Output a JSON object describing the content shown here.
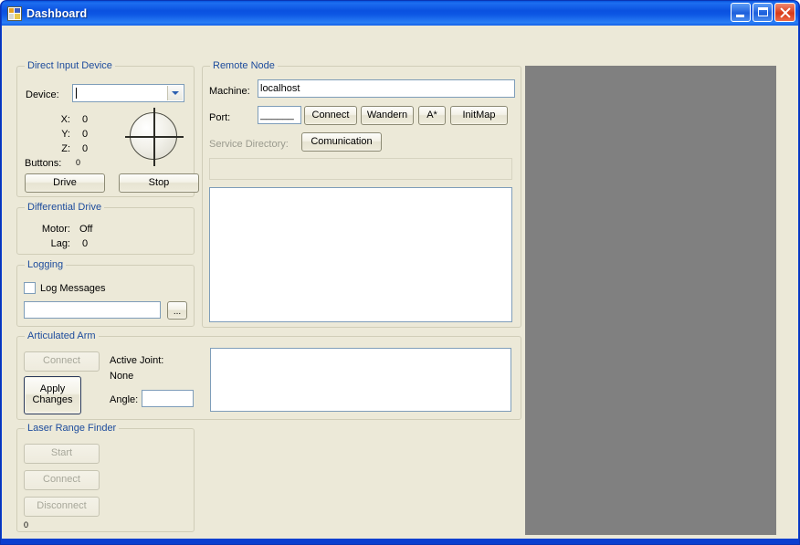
{
  "window": {
    "title": "Dashboard",
    "icon": "app-grid-icon",
    "controls": {
      "minimize": "Minimize",
      "maximize": "Maximize",
      "close": "Close"
    },
    "colors": {
      "titlebar": "#0d57e4",
      "client_background": "#ece9d8",
      "group_legend": "#1c4b9c",
      "render_panel": "#808080"
    }
  },
  "direct_input_device": {
    "legend": "Direct Input Device",
    "device_label": "Device:",
    "device_value": "",
    "device_placeholder": "",
    "axes": [
      {
        "label": "X:",
        "value": "0"
      },
      {
        "label": "Y:",
        "value": "0"
      },
      {
        "label": "Z:",
        "value": "0"
      }
    ],
    "buttons_label": "Buttons:",
    "buttons_value": "0",
    "drive_button": "Drive",
    "stop_button": "Stop",
    "joystick_icon": "joystick-crosshair-icon"
  },
  "differential_drive": {
    "legend": "Differential Drive",
    "motor_label": "Motor:",
    "motor_value": "Off",
    "lag_label": "Lag:",
    "lag_value": "0"
  },
  "logging": {
    "legend": "Logging",
    "log_messages_label": "Log Messages",
    "log_messages_checked": false,
    "path_value": "",
    "path_placeholder": "",
    "browse_button": "..."
  },
  "articulated_arm": {
    "legend": "Articulated Arm",
    "connect_button": "Connect",
    "connect_enabled": false,
    "apply_button_line1": "Apply",
    "apply_button_line2": "Changes",
    "active_joint_label": "Active Joint:",
    "active_joint_value": "None",
    "angle_label": "Angle:",
    "angle_value": "",
    "joint_list_items": []
  },
  "laser_range_finder": {
    "legend": "Laser Range Finder",
    "start_button": "Start",
    "start_enabled": false,
    "connect_button": "Connect",
    "connect_enabled": false,
    "disconnect_button": "Disconnect",
    "disconnect_enabled": false,
    "count_value": "0"
  },
  "remote_node": {
    "legend": "Remote Node",
    "machine_label": "Machine:",
    "machine_value": "localhost",
    "machine_placeholder": "",
    "port_label": "Port:",
    "port_value": "______",
    "port_placeholder": "",
    "buttons": [
      {
        "label": "Connect",
        "name": "connect-button"
      },
      {
        "label": "Wandern",
        "name": "wandern-button"
      },
      {
        "label": "A*",
        "name": "astar-button"
      },
      {
        "label": "InitMap",
        "name": "initmap-button"
      }
    ],
    "service_directory_label": "Service Directory:",
    "service_directory_enabled": false,
    "comunication_button": "Comunication",
    "service_list_items": [],
    "log_list_items": []
  }
}
